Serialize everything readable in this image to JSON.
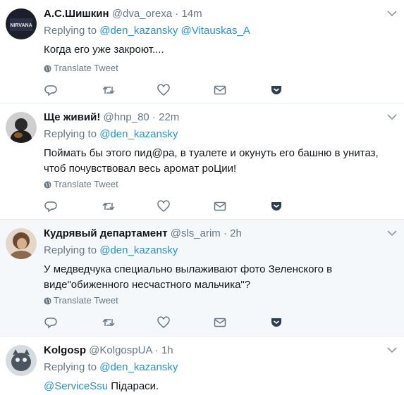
{
  "tweets": [
    {
      "name": "А.С.Шишкин",
      "handle": "@dva_orexa",
      "time": "14m",
      "replying_to_label": "Replying to",
      "reply_handles": [
        "@den_kazansky",
        "@Vitauskas_A"
      ],
      "text": "Когда его уже закроют....",
      "translate": "Translate Tweet",
      "avatar_text": "NIRVANA"
    },
    {
      "name": "Ще живий!",
      "handle": "@hnp_80",
      "time": "22m",
      "replying_to_label": "Replying to",
      "reply_handles": [
        "@den_kazansky"
      ],
      "text": "Поймать бы этого пид@ра, в туалете и окунуть его башню в унитаз, чтоб почувствовал весь аромат роЦии!",
      "translate": "Translate Tweet"
    },
    {
      "name": "Кудрявый департамент",
      "handle": "@sls_arim",
      "time": "2h",
      "replying_to_label": "Replying to",
      "reply_handles": [
        "@den_kazansky"
      ],
      "text": "У медведчука специально вылаживают фото Зеленского в виде\"обиженного несчастного мальчика\"?",
      "translate": "Translate Tweet"
    },
    {
      "name": "Kolgosp",
      "handle": "@KolgospUA",
      "time": "1h",
      "replying_to_label": "Replying to",
      "reply_handles": [
        "@den_kazansky"
      ],
      "mention": "@ServiceSsu",
      "text": "Підараси."
    }
  ],
  "colors": {
    "link": "#1b95e0",
    "muted": "#657786",
    "text": "#14171a",
    "highlight_bg": "#f5f8fa",
    "divider": "#e6ecf0"
  },
  "icons": [
    "chevron-down-icon",
    "globe-icon",
    "reply-icon",
    "retweet-icon",
    "like-icon",
    "direct-message-icon",
    "pocket-icon"
  ]
}
